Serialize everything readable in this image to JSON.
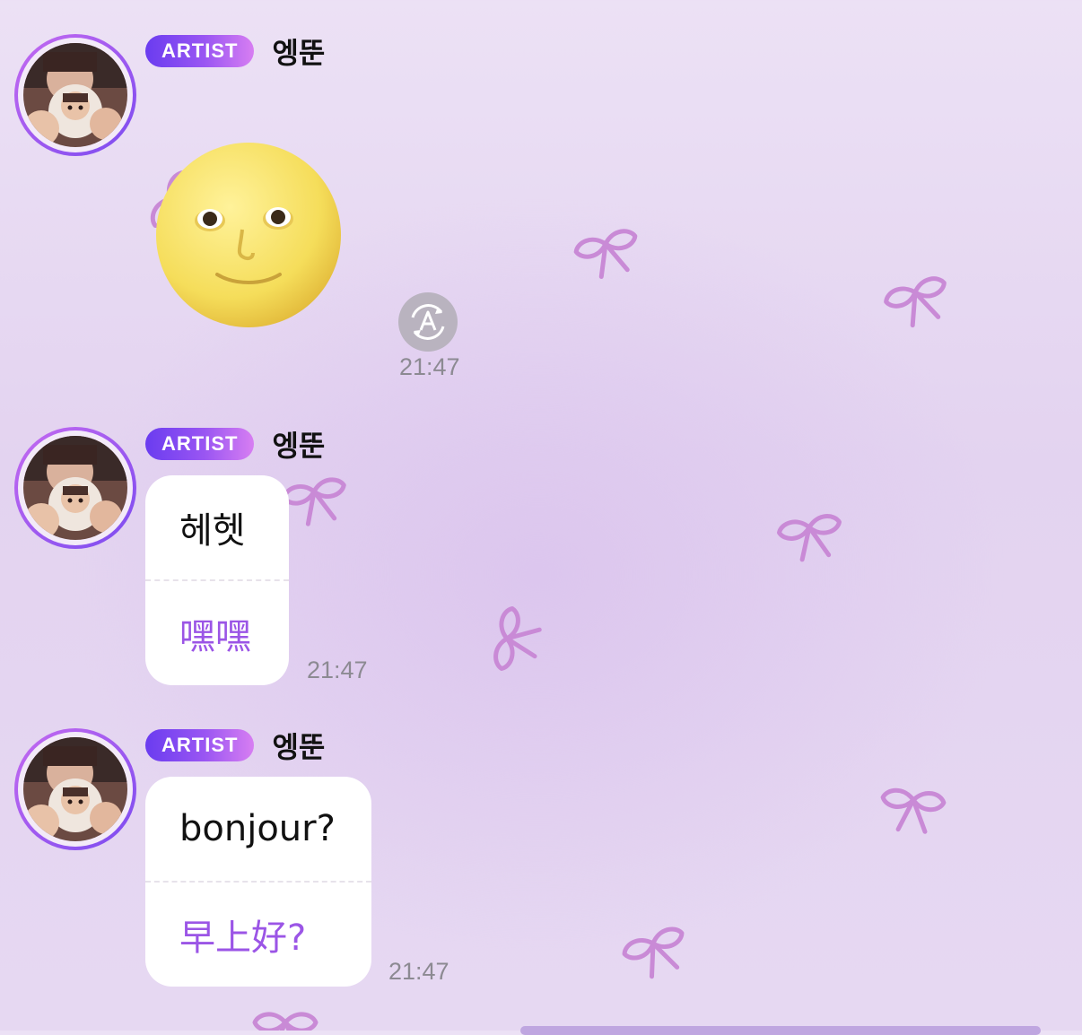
{
  "messages": [
    {
      "badge": "ARTIST",
      "sender": "엥뚠",
      "type": "emoji",
      "emoji": "full-moon-face",
      "time": "21:47"
    },
    {
      "badge": "ARTIST",
      "sender": "엥뚠",
      "type": "text",
      "original": "헤헷",
      "translation": "嘿嘿",
      "time": "21:47"
    },
    {
      "badge": "ARTIST",
      "sender": "엥뚠",
      "type": "text",
      "original": "bonjour?",
      "translation": "早上好?",
      "time": "21:47"
    }
  ],
  "icons": {
    "translate": "auto-translate-icon",
    "background": "ribbon-bow-icon"
  },
  "colors": {
    "badge_gradient_start": "#6a3cf0",
    "badge_gradient_end": "#d77ef2",
    "translation_text": "#9b55e6",
    "bow": "#c98ad6"
  }
}
